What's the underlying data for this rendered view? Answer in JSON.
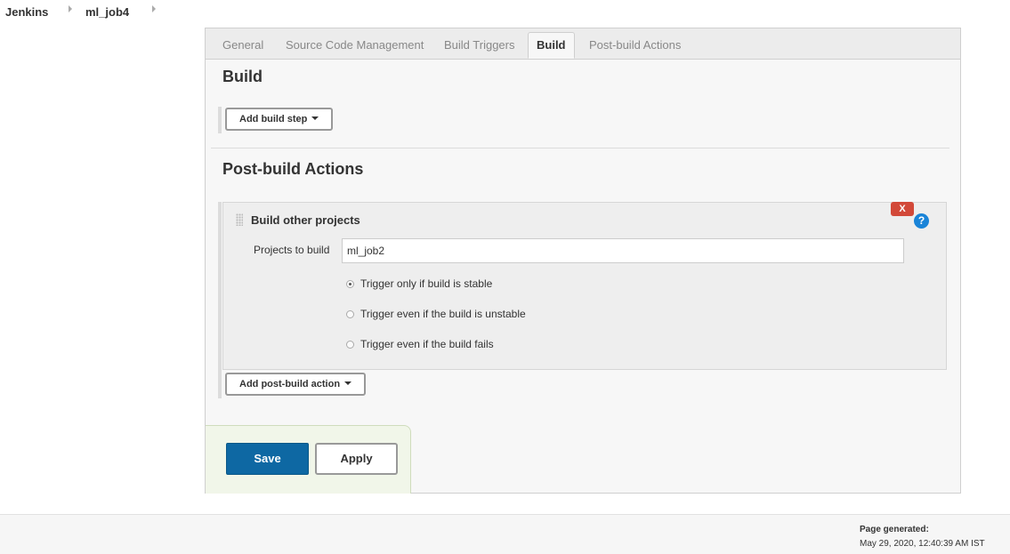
{
  "breadcrumb": {
    "items": [
      "Jenkins",
      "ml_job4"
    ]
  },
  "tabs": [
    {
      "label": "General",
      "active": false
    },
    {
      "label": "Source Code Management",
      "active": false
    },
    {
      "label": "Build Triggers",
      "active": false
    },
    {
      "label": "Build",
      "active": true
    },
    {
      "label": "Post-build Actions",
      "active": false
    }
  ],
  "build": {
    "title": "Build",
    "add_step_label": "Add build step"
  },
  "post_build": {
    "title": "Post-build Actions",
    "action": {
      "title": "Build other projects",
      "delete_label": "X",
      "help_label": "?",
      "projects_label": "Projects to build",
      "projects_value": "ml_job2",
      "options": [
        {
          "label": "Trigger only if build is stable",
          "checked": true
        },
        {
          "label": "Trigger even if the build is unstable",
          "checked": false
        },
        {
          "label": "Trigger even if the build fails",
          "checked": false
        }
      ]
    },
    "add_action_label": "Add post-build action"
  },
  "buttons": {
    "save": "Save",
    "apply": "Apply"
  },
  "footer": {
    "label": "Page generated:",
    "timestamp": "May 29, 2020, 12:40:39 AM IST"
  },
  "colors": {
    "save_button": "#0e68a3",
    "delete_button": "#d24939",
    "help_icon": "#1a84d8",
    "save_area": "#f1f6e9"
  }
}
